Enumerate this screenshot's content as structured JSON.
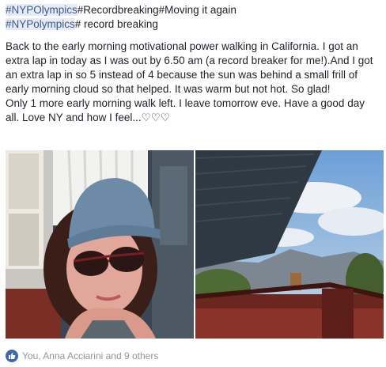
{
  "post": {
    "hashtags": {
      "tag1": "#NYPOlympics",
      "tag2": "#Recordbreaking",
      "tag3": "#Moving it again",
      "tag4": "#NYPolympics",
      "tag5": "# record breaking"
    },
    "body": {
      "paragraph1": "Back to the early morning motivational power walking in California. I got an extra lap in today as I was out by 6.50 am (a record breaker for me!).And I got an extra lap in so 5 instead of 4 because the sun was behind a small frill of early morning cloud so that helped. It was warm but not hot. So glad!",
      "paragraph2": "Only 1 more early morning walk left. I leave tomorrow eve. Have a good day all. Love NY and how I feel...♡♡♡"
    },
    "photos": {
      "left_icon": "selfie-photo",
      "right_icon": "balcony-view-photo"
    },
    "reactions": {
      "icon": "thumbs-up-icon",
      "text": "You, Anna Acciarini and 9 others",
      "accent_color": "#4267b2"
    }
  }
}
